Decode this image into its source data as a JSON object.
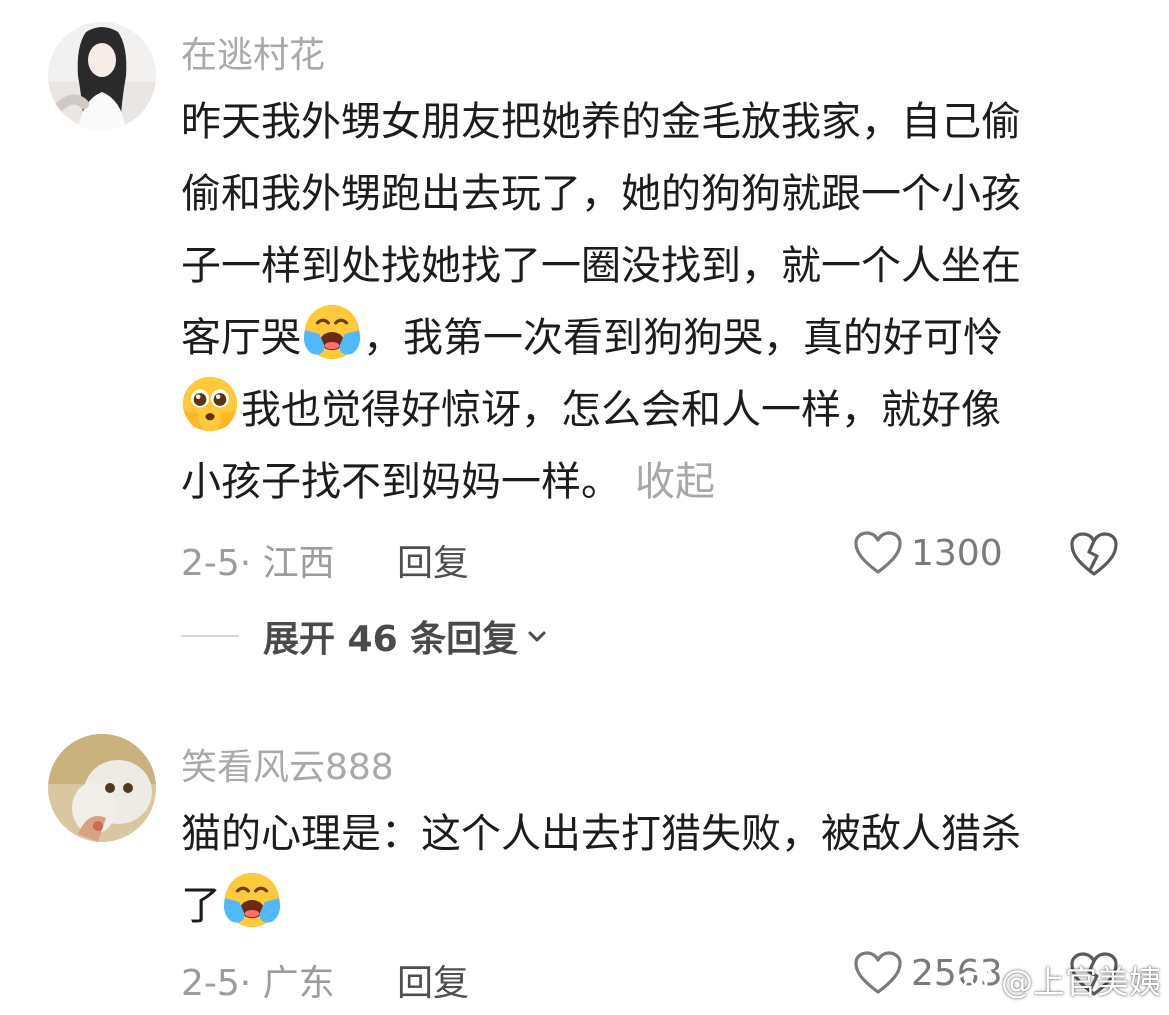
{
  "comments": [
    {
      "username": "在逃村花",
      "lines": [
        "昨天我外甥女朋友把她养的金毛放我家，自己偷",
        "偷和我外甥跑出去玩了，她的狗狗就跟一个小孩",
        "子一样到处找她找了一圈没找到，就一个人坐在"
      ],
      "line4_a": "客厅哭",
      "line4_b": "，我第一次看到狗狗哭，真的好可怜",
      "line5": "我也觉得好惊讶，怎么会和人一样，就好像",
      "line6": "小孩子找不到妈妈一样。",
      "collapse_label": "收起",
      "time_location": "2-5· 江西",
      "reply_label": "回复",
      "likes": "1300",
      "expand_label": "展开 46 条回复"
    },
    {
      "username": "笑看风云888",
      "line1": "猫的心理是：这个人出去打猎失败，被敌人猎杀",
      "line2": "了",
      "time_location": "2-5· 广东",
      "reply_label": "回复",
      "likes": "2563"
    }
  ],
  "watermark": "@上官美姨",
  "icons": {
    "emoji_crying": "loudly-crying-face-emoji",
    "emoji_pleading": "pleading-face-emoji",
    "like": "heart-outline-icon",
    "dislike": "broken-heart-icon",
    "expand": "chevron-down-icon",
    "watermark_logo": "weibo-logo-icon"
  },
  "colors": {
    "username": "#a9a9a9",
    "body_text": "#1c1c1c",
    "meta": "#9c9c9c",
    "reply": "#4f4f4f",
    "emoji_yellow": "#ffc93c"
  }
}
